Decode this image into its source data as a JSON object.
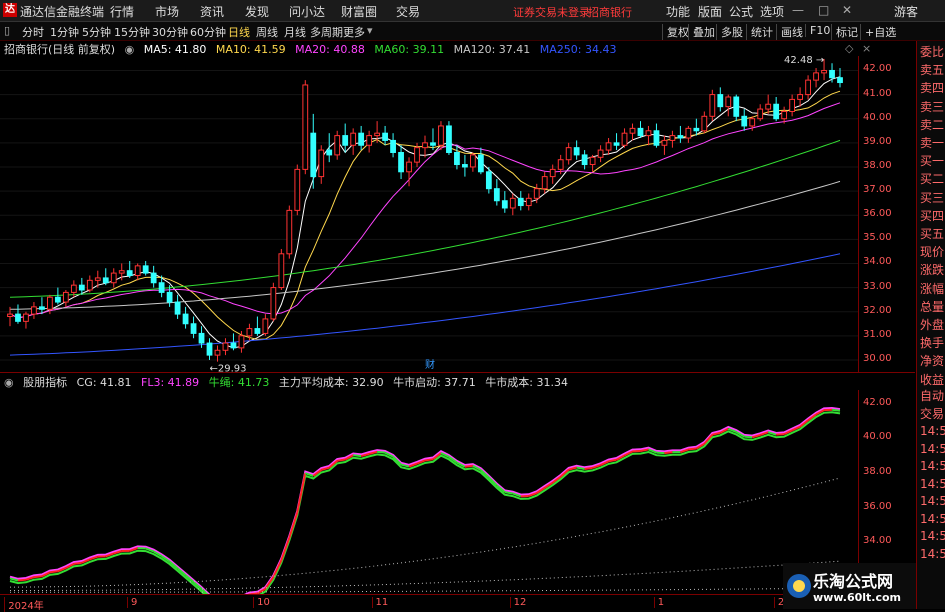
{
  "titlebar": {
    "logo": "达",
    "app_name": "通达信金融终端",
    "menus": [
      "行情",
      "市场",
      "资讯",
      "发现",
      "问小达",
      "财富圈",
      "交易"
    ],
    "warning": "证券交易未登录",
    "stock_name": "招商银行",
    "right_menus": [
      "功能",
      "版面",
      "公式",
      "选项"
    ],
    "guest": "游客"
  },
  "toolbar": {
    "periods": [
      "分时",
      "1分钟",
      "5分钟",
      "15分钟",
      "30分钟",
      "60分钟",
      "日线",
      "周线",
      "月线",
      "多周期",
      "更多"
    ],
    "active": "日线",
    "right_items": [
      "复权",
      "叠加",
      "多股",
      "统计",
      "画线",
      "F10",
      "标记",
      "+自选"
    ]
  },
  "ma_line": {
    "stock_label": "招商银行(日线 前复权)",
    "items": [
      {
        "label": "MA5: 41.80",
        "color": "#ffffff"
      },
      {
        "label": "MA10: 41.59",
        "color": "#ffd84d"
      },
      {
        "label": "MA20: 40.88",
        "color": "#ff44ff"
      },
      {
        "label": "MA60: 39.11",
        "color": "#33dd33"
      },
      {
        "label": "MA120: 37.41",
        "color": "#c8c8c8"
      },
      {
        "label": "MA250: 34.43",
        "color": "#3355ff"
      }
    ]
  },
  "ind_line": {
    "name": "股朋指标",
    "items": [
      {
        "label": "CG: 41.81",
        "color": "#dddddd"
      },
      {
        "label": "FL3: 41.89",
        "color": "#ff44ff"
      },
      {
        "label": "牛绳: 41.73",
        "color": "#33dd33"
      },
      {
        "label": "主力平均成本: 32.90",
        "color": "#dddddd"
      },
      {
        "label": "牛市启动: 37.71",
        "color": "#dddddd"
      },
      {
        "label": "牛市成本: 31.34",
        "color": "#dddddd"
      }
    ]
  },
  "price_axis": [
    "42.00",
    "41.00",
    "40.00",
    "39.00",
    "38.00",
    "37.00",
    "36.00",
    "35.00",
    "34.00",
    "33.00",
    "32.00",
    "31.00",
    "30.00"
  ],
  "ind_axis": [
    "42.00",
    "40.00",
    "38.00",
    "36.00",
    "34.00",
    "32.00"
  ],
  "side_top": [
    "委比",
    "卖五",
    "卖四",
    "卖三",
    "卖二",
    "卖一",
    "买一",
    "买二",
    "买三",
    "买四",
    "买五",
    "现价",
    "涨跌",
    "涨幅",
    "总量",
    "外盘",
    "换手",
    "净资",
    "收益"
  ],
  "side_bottom": [
    "自动",
    "交易",
    "14:5",
    "14:5",
    "14:5",
    "14:5",
    "14:5",
    "14:5",
    "14:5",
    "14:5"
  ],
  "xaxis": [
    {
      "label": "2024年",
      "pos": 0.005
    },
    {
      "label": "9",
      "pos": 0.148
    },
    {
      "label": "10",
      "pos": 0.295
    },
    {
      "label": "11",
      "pos": 0.433
    },
    {
      "label": "12",
      "pos": 0.594
    },
    {
      "label": "1",
      "pos": 0.762
    },
    {
      "label": "2",
      "pos": 0.902
    }
  ],
  "annotations": {
    "high": "42.48",
    "low": "29.93",
    "marker": "财"
  },
  "chart_data": {
    "type": "candlestick",
    "ylim": [
      29.5,
      42.6
    ],
    "ohlc": [
      [
        31.8,
        32.2,
        31.4,
        31.9
      ],
      [
        31.9,
        32.3,
        31.5,
        31.6
      ],
      [
        31.6,
        32.0,
        31.3,
        31.9
      ],
      [
        31.9,
        32.4,
        31.7,
        32.2
      ],
      [
        32.2,
        32.6,
        31.9,
        32.1
      ],
      [
        32.1,
        32.7,
        31.9,
        32.6
      ],
      [
        32.6,
        33.0,
        32.3,
        32.4
      ],
      [
        32.4,
        32.9,
        32.2,
        32.8
      ],
      [
        32.8,
        33.3,
        32.6,
        33.1
      ],
      [
        33.1,
        33.4,
        32.7,
        32.9
      ],
      [
        32.9,
        33.5,
        32.8,
        33.3
      ],
      [
        33.3,
        33.7,
        33.0,
        33.4
      ],
      [
        33.4,
        33.8,
        33.1,
        33.2
      ],
      [
        33.2,
        33.8,
        33.0,
        33.6
      ],
      [
        33.6,
        34.0,
        33.3,
        33.7
      ],
      [
        33.7,
        34.1,
        33.4,
        33.5
      ],
      [
        33.5,
        34.0,
        33.3,
        33.9
      ],
      [
        33.9,
        34.1,
        33.5,
        33.6
      ],
      [
        33.6,
        33.9,
        33.0,
        33.2
      ],
      [
        33.2,
        33.5,
        32.6,
        32.8
      ],
      [
        32.8,
        33.1,
        32.2,
        32.4
      ],
      [
        32.4,
        32.7,
        31.7,
        31.9
      ],
      [
        31.9,
        32.2,
        31.3,
        31.5
      ],
      [
        31.5,
        31.8,
        30.9,
        31.1
      ],
      [
        31.1,
        31.4,
        30.5,
        30.7
      ],
      [
        30.7,
        30.9,
        30.0,
        30.2
      ],
      [
        30.2,
        30.6,
        29.93,
        30.4
      ],
      [
        30.4,
        30.9,
        30.2,
        30.7
      ],
      [
        30.7,
        31.1,
        30.4,
        30.5
      ],
      [
        30.5,
        31.2,
        30.3,
        31.0
      ],
      [
        31.0,
        31.5,
        30.8,
        31.3
      ],
      [
        31.3,
        31.8,
        31.0,
        31.1
      ],
      [
        31.1,
        31.9,
        31.0,
        31.7
      ],
      [
        31.7,
        33.2,
        31.6,
        33.0
      ],
      [
        33.0,
        34.6,
        32.9,
        34.4
      ],
      [
        34.4,
        36.4,
        34.2,
        36.2
      ],
      [
        36.2,
        38.1,
        36.0,
        37.9
      ],
      [
        37.9,
        41.6,
        37.7,
        41.4
      ],
      [
        39.4,
        40.2,
        37.1,
        37.6
      ],
      [
        37.6,
        38.9,
        37.3,
        38.7
      ],
      [
        38.7,
        39.4,
        38.2,
        38.5
      ],
      [
        38.5,
        39.5,
        38.3,
        39.3
      ],
      [
        39.3,
        39.8,
        38.6,
        38.9
      ],
      [
        38.9,
        39.6,
        38.5,
        39.4
      ],
      [
        39.4,
        39.7,
        38.7,
        38.9
      ],
      [
        38.9,
        39.5,
        38.6,
        39.3
      ],
      [
        39.3,
        39.9,
        39.0,
        39.4
      ],
      [
        39.4,
        39.7,
        38.9,
        39.1
      ],
      [
        39.1,
        39.4,
        38.4,
        38.6
      ],
      [
        38.6,
        38.9,
        37.5,
        37.8
      ],
      [
        37.8,
        38.4,
        37.2,
        38.2
      ],
      [
        38.2,
        39.0,
        38.0,
        38.8
      ],
      [
        38.8,
        39.3,
        38.4,
        39.0
      ],
      [
        39.0,
        39.6,
        38.7,
        38.9
      ],
      [
        38.9,
        39.9,
        38.7,
        39.7
      ],
      [
        39.7,
        39.9,
        38.5,
        38.6
      ],
      [
        38.6,
        38.9,
        37.9,
        38.1
      ],
      [
        38.1,
        38.5,
        37.6,
        38.0
      ],
      [
        38.0,
        38.6,
        37.8,
        38.5
      ],
      [
        38.5,
        38.8,
        37.7,
        37.8
      ],
      [
        37.8,
        38.0,
        36.9,
        37.1
      ],
      [
        37.1,
        37.5,
        36.4,
        36.6
      ],
      [
        36.6,
        37.0,
        36.1,
        36.3
      ],
      [
        36.3,
        36.9,
        36.0,
        36.7
      ],
      [
        36.7,
        37.0,
        36.2,
        36.4
      ],
      [
        36.4,
        36.9,
        36.2,
        36.7
      ],
      [
        36.7,
        37.3,
        36.5,
        37.1
      ],
      [
        37.1,
        37.8,
        36.9,
        37.6
      ],
      [
        37.6,
        38.1,
        37.3,
        37.9
      ],
      [
        37.9,
        38.5,
        37.7,
        38.3
      ],
      [
        38.3,
        39.0,
        38.1,
        38.8
      ],
      [
        38.8,
        39.1,
        38.3,
        38.5
      ],
      [
        38.5,
        38.7,
        37.9,
        38.1
      ],
      [
        38.1,
        38.5,
        37.8,
        38.4
      ],
      [
        38.4,
        38.9,
        38.2,
        38.7
      ],
      [
        38.7,
        39.2,
        38.5,
        39.0
      ],
      [
        39.0,
        39.4,
        38.7,
        38.9
      ],
      [
        38.9,
        39.6,
        38.8,
        39.4
      ],
      [
        39.4,
        39.8,
        39.1,
        39.6
      ],
      [
        39.6,
        39.9,
        39.2,
        39.3
      ],
      [
        39.3,
        39.7,
        38.9,
        39.5
      ],
      [
        39.5,
        39.8,
        38.8,
        38.9
      ],
      [
        38.9,
        39.3,
        38.5,
        39.1
      ],
      [
        39.1,
        39.5,
        38.8,
        39.3
      ],
      [
        39.3,
        39.7,
        39.0,
        39.2
      ],
      [
        39.2,
        39.7,
        39.0,
        39.6
      ],
      [
        39.6,
        40.0,
        39.3,
        39.5
      ],
      [
        39.5,
        40.3,
        39.4,
        40.1
      ],
      [
        40.1,
        41.2,
        39.9,
        41.0
      ],
      [
        41.0,
        41.3,
        40.3,
        40.5
      ],
      [
        40.5,
        41.0,
        40.1,
        40.9
      ],
      [
        40.9,
        41.0,
        39.9,
        40.1
      ],
      [
        40.1,
        40.4,
        39.5,
        39.7
      ],
      [
        39.7,
        40.1,
        39.5,
        40.0
      ],
      [
        40.0,
        40.6,
        39.9,
        40.4
      ],
      [
        40.4,
        41.0,
        40.2,
        40.6
      ],
      [
        40.6,
        40.9,
        39.9,
        40.0
      ],
      [
        40.0,
        40.5,
        39.8,
        40.3
      ],
      [
        40.3,
        41.0,
        40.1,
        40.8
      ],
      [
        40.8,
        41.3,
        40.5,
        41.0
      ],
      [
        41.0,
        41.8,
        40.8,
        41.6
      ],
      [
        41.6,
        42.1,
        41.3,
        41.9
      ],
      [
        41.9,
        42.48,
        41.6,
        42.0
      ],
      [
        42.0,
        42.3,
        41.5,
        41.7
      ],
      [
        41.7,
        42.1,
        41.3,
        41.5
      ]
    ]
  }
}
